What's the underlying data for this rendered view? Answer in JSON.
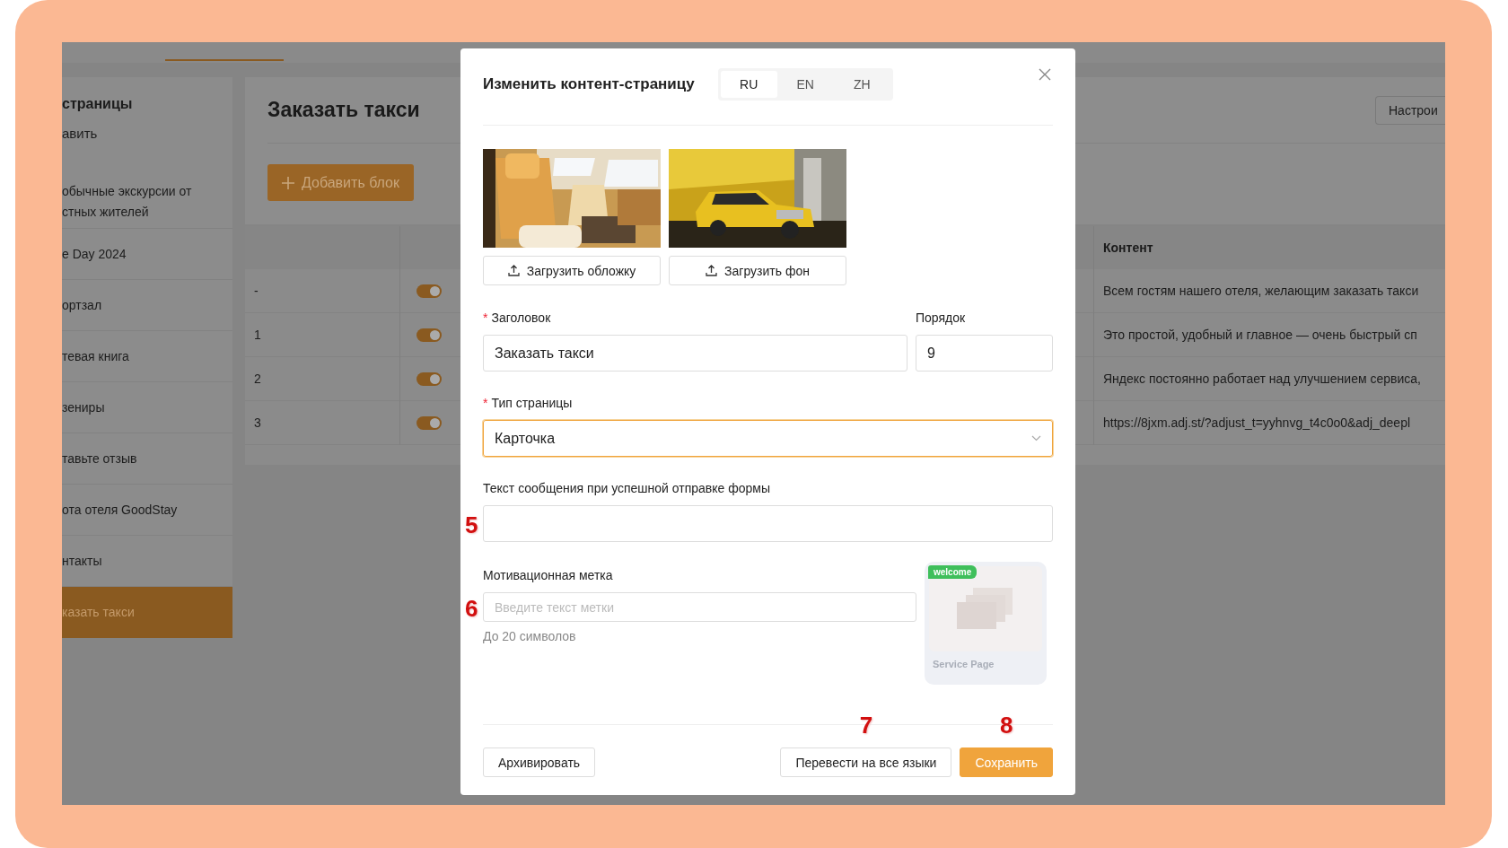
{
  "sidebar": {
    "title": "страницы",
    "add_link": "авить",
    "items": [
      {
        "label": "обычные экскурсии от\nстных жителей",
        "selected": false
      },
      {
        "label": "e Day 2024",
        "selected": false
      },
      {
        "label": "ортзал",
        "selected": false
      },
      {
        "label": "тевая книга",
        "selected": false
      },
      {
        "label": "зениры",
        "selected": false
      },
      {
        "label": "тавьте отзыв",
        "selected": false
      },
      {
        "label": "ота отеля GoodStay",
        "selected": false
      },
      {
        "label": "нтакты",
        "selected": false
      },
      {
        "label": "казать такси",
        "selected": true
      }
    ]
  },
  "page": {
    "title": "Заказать такси",
    "add_block_button": "Добавить блок",
    "settings_button": "Настрои"
  },
  "table": {
    "content_column": "Контент",
    "rows": [
      {
        "number": "-",
        "on": true,
        "content": "Всем гостям нашего отеля, желающим заказать такси"
      },
      {
        "number": "1",
        "on": true,
        "content": "Это простой, удобный и главное — очень быстрый сп"
      },
      {
        "number": "2",
        "on": true,
        "content": "Яндекс постоянно работает над улучшением сервиса,"
      },
      {
        "number": "3",
        "on": true,
        "content": "https://8jxm.adj.st/?adjust_t=yyhnvg_t4c0o0&adj_deepl"
      }
    ]
  },
  "modal": {
    "title": "Изменить контент-страницу",
    "languages": [
      {
        "label": "RU",
        "selected": true
      },
      {
        "label": "EN",
        "selected": false
      },
      {
        "label": "ZH",
        "selected": false
      }
    ],
    "images": [
      {
        "kind": "picture",
        "upload_button": "Загрузить обложку"
      },
      {
        "kind": "picture",
        "upload_button": "Загрузить фон"
      }
    ],
    "title_field": {
      "required_mark": "*",
      "label": "Заголовок",
      "value": "Заказать такси"
    },
    "order_field": {
      "label": "Порядок",
      "value": "9"
    },
    "page_type": {
      "required_mark": "*",
      "label": "Тип страницы",
      "value": "Карточка",
      "focused": true
    },
    "success_message": {
      "label": "Текст сообщения при успешной отправке формы",
      "annotation": "5"
    },
    "badge_field": {
      "label": "Мотивационная метка",
      "placeholder": "Введите текст метки",
      "hint": "До 20 символов",
      "annotation": "6"
    },
    "preview": {
      "badge": "welcome",
      "caption": "Service Page"
    },
    "buttons": [
      {
        "kind": "secondary",
        "label": "Архивировать"
      },
      {
        "kind": "secondary",
        "label": "Перевести на все языки",
        "annotation": "7"
      },
      {
        "kind": "primary",
        "label": "Сохранить",
        "annotation": "8"
      }
    ]
  }
}
